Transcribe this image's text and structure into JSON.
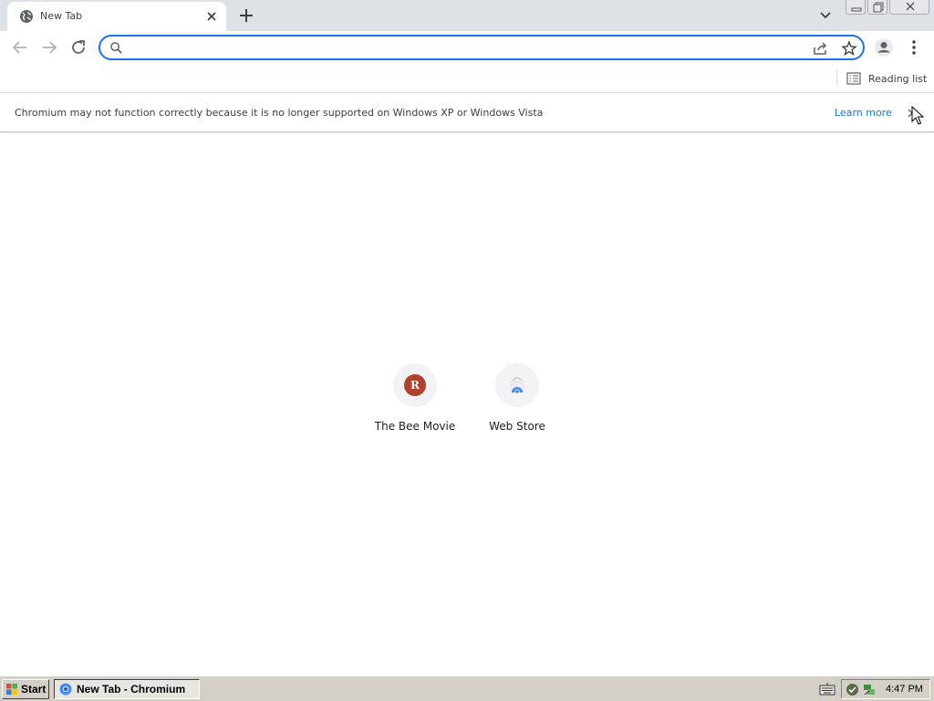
{
  "window": {
    "tab_title": "New Tab"
  },
  "toolbar": {
    "omnibox_value": ""
  },
  "bookmarks_bar": {
    "reading_list_label": "Reading list"
  },
  "infobar": {
    "message": "Chromium may not function correctly because it is no longer supported on Windows XP or Windows Vista",
    "link_label": "Learn more"
  },
  "shortcuts": [
    {
      "label": "The Bee Movie",
      "icon_letter": "R",
      "icon_color": "#b1412c"
    },
    {
      "label": "Web Store",
      "icon": "web-store-icon"
    }
  ],
  "taskbar": {
    "start_label": "Start",
    "task_label": "New Tab - Chromium",
    "clock": "4:47 PM"
  },
  "colors": {
    "accent": "#1a73e8",
    "tabstrip": "#dee1e6",
    "taskbar": "#d4d0c8"
  }
}
